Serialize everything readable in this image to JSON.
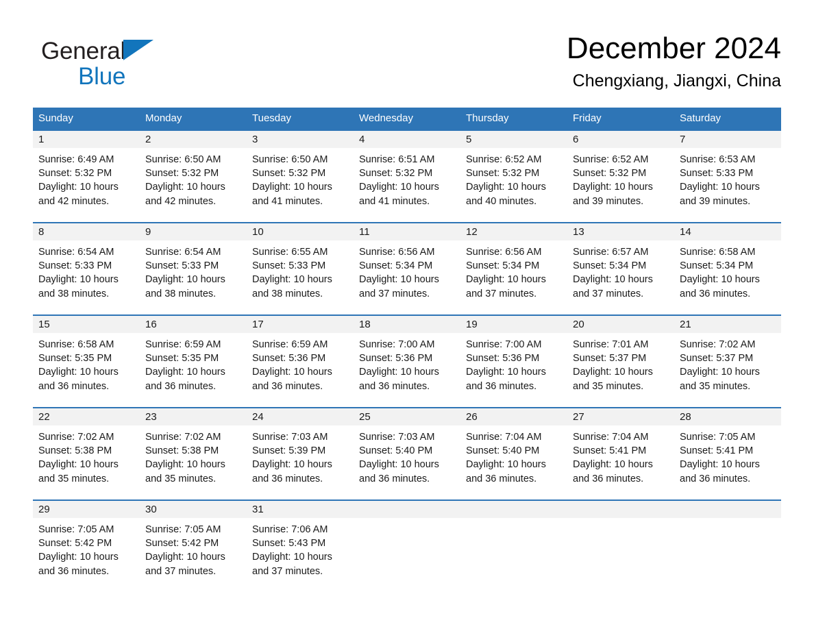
{
  "brand": {
    "name_part1": "General",
    "name_part2": "Blue",
    "flag_icon": "brand-triangle-icon",
    "colors": {
      "blue": "#1275bc",
      "black": "#231f20"
    }
  },
  "header": {
    "month_title": "December 2024",
    "location": "Chengxiang, Jiangxi, China"
  },
  "theme": {
    "header_blue": "#2e75b6",
    "row_divider_blue": "#2e75b6",
    "day_number_band": "#f2f2f2",
    "text": "#1a1a1a"
  },
  "weekdays": [
    "Sunday",
    "Monday",
    "Tuesday",
    "Wednesday",
    "Thursday",
    "Friday",
    "Saturday"
  ],
  "weeks": [
    [
      {
        "day": "1",
        "sunrise": "Sunrise: 6:49 AM",
        "sunset": "Sunset: 5:32 PM",
        "daylight": "Daylight: 10 hours and 42 minutes."
      },
      {
        "day": "2",
        "sunrise": "Sunrise: 6:50 AM",
        "sunset": "Sunset: 5:32 PM",
        "daylight": "Daylight: 10 hours and 42 minutes."
      },
      {
        "day": "3",
        "sunrise": "Sunrise: 6:50 AM",
        "sunset": "Sunset: 5:32 PM",
        "daylight": "Daylight: 10 hours and 41 minutes."
      },
      {
        "day": "4",
        "sunrise": "Sunrise: 6:51 AM",
        "sunset": "Sunset: 5:32 PM",
        "daylight": "Daylight: 10 hours and 41 minutes."
      },
      {
        "day": "5",
        "sunrise": "Sunrise: 6:52 AM",
        "sunset": "Sunset: 5:32 PM",
        "daylight": "Daylight: 10 hours and 40 minutes."
      },
      {
        "day": "6",
        "sunrise": "Sunrise: 6:52 AM",
        "sunset": "Sunset: 5:32 PM",
        "daylight": "Daylight: 10 hours and 39 minutes."
      },
      {
        "day": "7",
        "sunrise": "Sunrise: 6:53 AM",
        "sunset": "Sunset: 5:33 PM",
        "daylight": "Daylight: 10 hours and 39 minutes."
      }
    ],
    [
      {
        "day": "8",
        "sunrise": "Sunrise: 6:54 AM",
        "sunset": "Sunset: 5:33 PM",
        "daylight": "Daylight: 10 hours and 38 minutes."
      },
      {
        "day": "9",
        "sunrise": "Sunrise: 6:54 AM",
        "sunset": "Sunset: 5:33 PM",
        "daylight": "Daylight: 10 hours and 38 minutes."
      },
      {
        "day": "10",
        "sunrise": "Sunrise: 6:55 AM",
        "sunset": "Sunset: 5:33 PM",
        "daylight": "Daylight: 10 hours and 38 minutes."
      },
      {
        "day": "11",
        "sunrise": "Sunrise: 6:56 AM",
        "sunset": "Sunset: 5:34 PM",
        "daylight": "Daylight: 10 hours and 37 minutes."
      },
      {
        "day": "12",
        "sunrise": "Sunrise: 6:56 AM",
        "sunset": "Sunset: 5:34 PM",
        "daylight": "Daylight: 10 hours and 37 minutes."
      },
      {
        "day": "13",
        "sunrise": "Sunrise: 6:57 AM",
        "sunset": "Sunset: 5:34 PM",
        "daylight": "Daylight: 10 hours and 37 minutes."
      },
      {
        "day": "14",
        "sunrise": "Sunrise: 6:58 AM",
        "sunset": "Sunset: 5:34 PM",
        "daylight": "Daylight: 10 hours and 36 minutes."
      }
    ],
    [
      {
        "day": "15",
        "sunrise": "Sunrise: 6:58 AM",
        "sunset": "Sunset: 5:35 PM",
        "daylight": "Daylight: 10 hours and 36 minutes."
      },
      {
        "day": "16",
        "sunrise": "Sunrise: 6:59 AM",
        "sunset": "Sunset: 5:35 PM",
        "daylight": "Daylight: 10 hours and 36 minutes."
      },
      {
        "day": "17",
        "sunrise": "Sunrise: 6:59 AM",
        "sunset": "Sunset: 5:36 PM",
        "daylight": "Daylight: 10 hours and 36 minutes."
      },
      {
        "day": "18",
        "sunrise": "Sunrise: 7:00 AM",
        "sunset": "Sunset: 5:36 PM",
        "daylight": "Daylight: 10 hours and 36 minutes."
      },
      {
        "day": "19",
        "sunrise": "Sunrise: 7:00 AM",
        "sunset": "Sunset: 5:36 PM",
        "daylight": "Daylight: 10 hours and 36 minutes."
      },
      {
        "day": "20",
        "sunrise": "Sunrise: 7:01 AM",
        "sunset": "Sunset: 5:37 PM",
        "daylight": "Daylight: 10 hours and 35 minutes."
      },
      {
        "day": "21",
        "sunrise": "Sunrise: 7:02 AM",
        "sunset": "Sunset: 5:37 PM",
        "daylight": "Daylight: 10 hours and 35 minutes."
      }
    ],
    [
      {
        "day": "22",
        "sunrise": "Sunrise: 7:02 AM",
        "sunset": "Sunset: 5:38 PM",
        "daylight": "Daylight: 10 hours and 35 minutes."
      },
      {
        "day": "23",
        "sunrise": "Sunrise: 7:02 AM",
        "sunset": "Sunset: 5:38 PM",
        "daylight": "Daylight: 10 hours and 35 minutes."
      },
      {
        "day": "24",
        "sunrise": "Sunrise: 7:03 AM",
        "sunset": "Sunset: 5:39 PM",
        "daylight": "Daylight: 10 hours and 36 minutes."
      },
      {
        "day": "25",
        "sunrise": "Sunrise: 7:03 AM",
        "sunset": "Sunset: 5:40 PM",
        "daylight": "Daylight: 10 hours and 36 minutes."
      },
      {
        "day": "26",
        "sunrise": "Sunrise: 7:04 AM",
        "sunset": "Sunset: 5:40 PM",
        "daylight": "Daylight: 10 hours and 36 minutes."
      },
      {
        "day": "27",
        "sunrise": "Sunrise: 7:04 AM",
        "sunset": "Sunset: 5:41 PM",
        "daylight": "Daylight: 10 hours and 36 minutes."
      },
      {
        "day": "28",
        "sunrise": "Sunrise: 7:05 AM",
        "sunset": "Sunset: 5:41 PM",
        "daylight": "Daylight: 10 hours and 36 minutes."
      }
    ],
    [
      {
        "day": "29",
        "sunrise": "Sunrise: 7:05 AM",
        "sunset": "Sunset: 5:42 PM",
        "daylight": "Daylight: 10 hours and 36 minutes."
      },
      {
        "day": "30",
        "sunrise": "Sunrise: 7:05 AM",
        "sunset": "Sunset: 5:42 PM",
        "daylight": "Daylight: 10 hours and 37 minutes."
      },
      {
        "day": "31",
        "sunrise": "Sunrise: 7:06 AM",
        "sunset": "Sunset: 5:43 PM",
        "daylight": "Daylight: 10 hours and 37 minutes."
      },
      {
        "day": "",
        "sunrise": "",
        "sunset": "",
        "daylight": ""
      },
      {
        "day": "",
        "sunrise": "",
        "sunset": "",
        "daylight": ""
      },
      {
        "day": "",
        "sunrise": "",
        "sunset": "",
        "daylight": ""
      },
      {
        "day": "",
        "sunrise": "",
        "sunset": "",
        "daylight": ""
      }
    ]
  ]
}
